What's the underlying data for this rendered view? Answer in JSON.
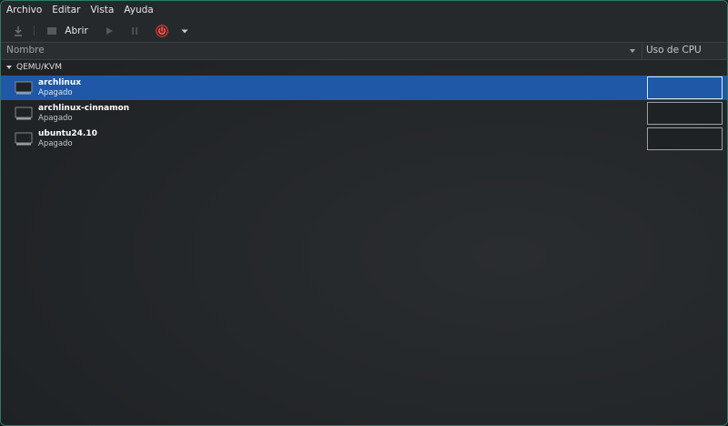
{
  "menu": [
    "Archivo",
    "Editar",
    "Vista",
    "Ayuda"
  ],
  "toolbar": {
    "open_label": "Abrir",
    "icons": [
      "new-vm-icon",
      "open-console-icon",
      "play-icon",
      "pause-icon",
      "power-icon",
      "chevron-down-icon"
    ],
    "power_color": "#e0443e"
  },
  "header": {
    "name": "Nombre",
    "cpu": "Uso de CPU"
  },
  "group": {
    "label": "QEMU/KVM"
  },
  "vms": [
    {
      "name": "archlinux",
      "state": "Apagado",
      "selected": true
    },
    {
      "name": "archlinux-cinnamon",
      "state": "Apagado",
      "selected": false
    },
    {
      "name": "ubuntu24.10",
      "state": "Apagado",
      "selected": false
    }
  ],
  "colors": {
    "selection": "#1e58a6",
    "accent_border": "#2f7a63"
  }
}
